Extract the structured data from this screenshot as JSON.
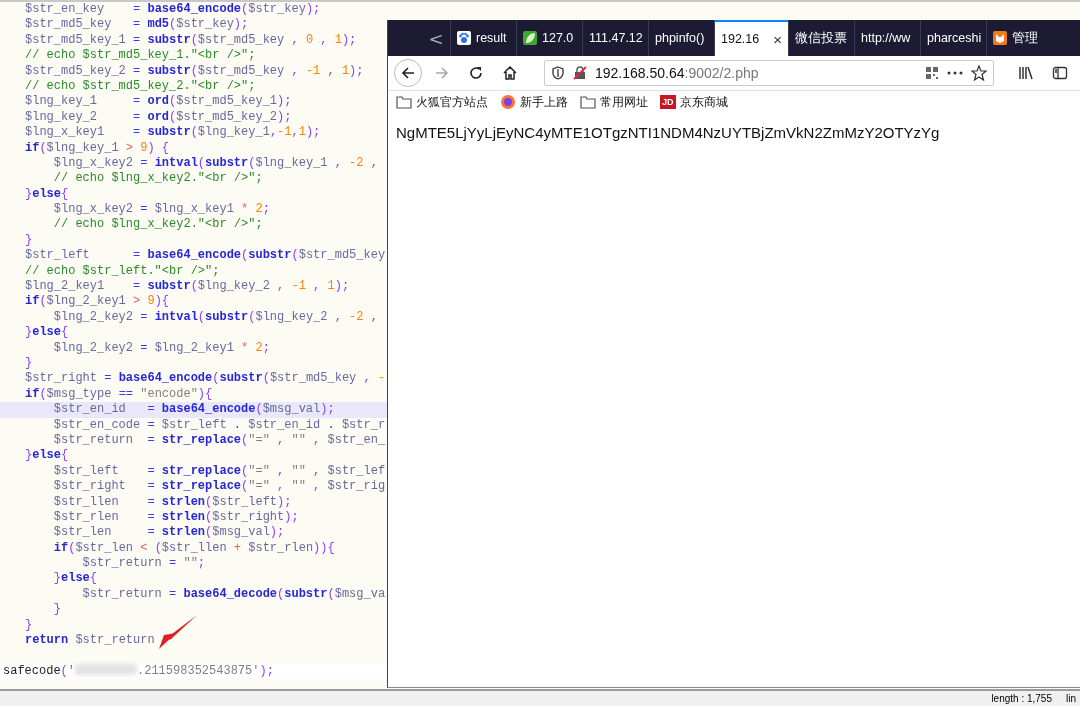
{
  "editor": {
    "lines": [
      {
        "tokens": [
          {
            "kind": "var",
            "text": "$str_en_key    "
          },
          {
            "kind": "op",
            "text": "= "
          },
          {
            "kind": "fn",
            "text": "base64_encode"
          },
          {
            "kind": "punct",
            "text": "("
          },
          {
            "kind": "var",
            "text": "$str_key"
          },
          {
            "kind": "punct",
            "text": ");"
          }
        ]
      },
      {
        "tokens": [
          {
            "kind": "var",
            "text": "$str_md5_key   "
          },
          {
            "kind": "op",
            "text": "= "
          },
          {
            "kind": "fn",
            "text": "md5"
          },
          {
            "kind": "punct",
            "text": "("
          },
          {
            "kind": "var",
            "text": "$str_key"
          },
          {
            "kind": "punct",
            "text": ");"
          }
        ]
      },
      {
        "tokens": [
          {
            "kind": "var",
            "text": "$str_md5_key_1 "
          },
          {
            "kind": "op",
            "text": "= "
          },
          {
            "kind": "fn",
            "text": "substr"
          },
          {
            "kind": "punct",
            "text": "("
          },
          {
            "kind": "var",
            "text": "$str_md5_key "
          },
          {
            "kind": "punct",
            "text": ", "
          },
          {
            "kind": "num",
            "text": "0 "
          },
          {
            "kind": "punct",
            "text": ", "
          },
          {
            "kind": "num",
            "text": "1"
          },
          {
            "kind": "punct",
            "text": ");"
          }
        ]
      },
      {
        "tokens": [
          {
            "kind": "comment",
            "text": "// echo $str_md5_key_1.\"<br />\";"
          }
        ]
      },
      {
        "tokens": [
          {
            "kind": "var",
            "text": "$str_md5_key_2 "
          },
          {
            "kind": "op",
            "text": "= "
          },
          {
            "kind": "fn",
            "text": "substr"
          },
          {
            "kind": "punct",
            "text": "("
          },
          {
            "kind": "var",
            "text": "$str_md5_key "
          },
          {
            "kind": "punct",
            "text": ", "
          },
          {
            "kind": "num",
            "text": "-1 "
          },
          {
            "kind": "punct",
            "text": ", "
          },
          {
            "kind": "num",
            "text": "1"
          },
          {
            "kind": "punct",
            "text": ");"
          }
        ]
      },
      {
        "tokens": [
          {
            "kind": "comment",
            "text": "// echo $str_md5_key_2.\"<br />\";"
          }
        ]
      },
      {
        "tokens": [
          {
            "kind": "var",
            "text": "$lng_key_1     "
          },
          {
            "kind": "op",
            "text": "= "
          },
          {
            "kind": "fn",
            "text": "ord"
          },
          {
            "kind": "punct",
            "text": "("
          },
          {
            "kind": "var",
            "text": "$str_md5_key_1"
          },
          {
            "kind": "punct",
            "text": ");"
          }
        ]
      },
      {
        "tokens": [
          {
            "kind": "var",
            "text": "$lng_key_2     "
          },
          {
            "kind": "op",
            "text": "= "
          },
          {
            "kind": "fn",
            "text": "ord"
          },
          {
            "kind": "punct",
            "text": "("
          },
          {
            "kind": "var",
            "text": "$str_md5_key_2"
          },
          {
            "kind": "punct",
            "text": ");"
          }
        ]
      },
      {
        "tokens": [
          {
            "kind": "var",
            "text": "$lng_x_key1    "
          },
          {
            "kind": "op",
            "text": "= "
          },
          {
            "kind": "fn",
            "text": "substr"
          },
          {
            "kind": "punct",
            "text": "("
          },
          {
            "kind": "var",
            "text": "$lng_key_1"
          },
          {
            "kind": "punct",
            "text": ","
          },
          {
            "kind": "num",
            "text": "-1"
          },
          {
            "kind": "punct",
            "text": ","
          },
          {
            "kind": "num",
            "text": "1"
          },
          {
            "kind": "punct",
            "text": ");"
          }
        ]
      },
      {
        "tokens": [
          {
            "kind": "fn",
            "text": "if"
          },
          {
            "kind": "punct",
            "text": "("
          },
          {
            "kind": "var",
            "text": "$lng_key_1 "
          },
          {
            "kind": "cmp",
            "text": "> "
          },
          {
            "kind": "num",
            "text": "9"
          },
          {
            "kind": "punct",
            "text": ") {"
          }
        ]
      },
      {
        "tokens": [
          {
            "kind": "var",
            "text": "    $lng_x_key2 "
          },
          {
            "kind": "op",
            "text": "= "
          },
          {
            "kind": "fn",
            "text": "intval"
          },
          {
            "kind": "punct",
            "text": "("
          },
          {
            "kind": "fn",
            "text": "substr"
          },
          {
            "kind": "punct",
            "text": "("
          },
          {
            "kind": "var",
            "text": "$lng_key_1 "
          },
          {
            "kind": "punct",
            "text": ", "
          },
          {
            "kind": "num",
            "text": "-2 "
          },
          {
            "kind": "punct",
            "text": ","
          }
        ]
      },
      {
        "tokens": [
          {
            "kind": "comment",
            "text": "    // echo $lng_x_key2.\"<br />\";"
          }
        ]
      },
      {
        "tokens": [
          {
            "kind": "punct",
            "text": "}"
          },
          {
            "kind": "fn",
            "text": "else"
          },
          {
            "kind": "punct",
            "text": "{"
          }
        ]
      },
      {
        "tokens": [
          {
            "kind": "var",
            "text": "    $lng_x_key2 "
          },
          {
            "kind": "op",
            "text": "= "
          },
          {
            "kind": "var",
            "text": "$lng_x_key1 "
          },
          {
            "kind": "cmp",
            "text": "* "
          },
          {
            "kind": "num",
            "text": "2"
          },
          {
            "kind": "punct",
            "text": ";"
          }
        ]
      },
      {
        "tokens": [
          {
            "kind": "comment",
            "text": "    // echo $lng_x_key2.\"<br />\";"
          }
        ]
      },
      {
        "tokens": [
          {
            "kind": "punct",
            "text": "}"
          }
        ]
      },
      {
        "tokens": [
          {
            "kind": "var",
            "text": "$str_left      "
          },
          {
            "kind": "op",
            "text": "= "
          },
          {
            "kind": "fn",
            "text": "base64_encode"
          },
          {
            "kind": "punct",
            "text": "("
          },
          {
            "kind": "fn",
            "text": "substr"
          },
          {
            "kind": "punct",
            "text": "("
          },
          {
            "kind": "var",
            "text": "$str_md5_key"
          }
        ]
      },
      {
        "tokens": [
          {
            "kind": "comment",
            "text": "// echo $str_left.\"<br />\";"
          }
        ]
      },
      {
        "tokens": [
          {
            "kind": "var",
            "text": "$lng_2_key1    "
          },
          {
            "kind": "op",
            "text": "= "
          },
          {
            "kind": "fn",
            "text": "substr"
          },
          {
            "kind": "punct",
            "text": "("
          },
          {
            "kind": "var",
            "text": "$lng_key_2 "
          },
          {
            "kind": "punct",
            "text": ", "
          },
          {
            "kind": "num",
            "text": "-1 "
          },
          {
            "kind": "punct",
            "text": ", "
          },
          {
            "kind": "num",
            "text": "1"
          },
          {
            "kind": "punct",
            "text": ");"
          }
        ]
      },
      {
        "tokens": [
          {
            "kind": "fn",
            "text": "if"
          },
          {
            "kind": "punct",
            "text": "("
          },
          {
            "kind": "var",
            "text": "$lng_2_key1 "
          },
          {
            "kind": "cmp",
            "text": "> "
          },
          {
            "kind": "num",
            "text": "9"
          },
          {
            "kind": "punct",
            "text": "){"
          }
        ]
      },
      {
        "tokens": [
          {
            "kind": "var",
            "text": "    $lng_2_key2 "
          },
          {
            "kind": "op",
            "text": "= "
          },
          {
            "kind": "fn",
            "text": "intval"
          },
          {
            "kind": "punct",
            "text": "("
          },
          {
            "kind": "fn",
            "text": "substr"
          },
          {
            "kind": "punct",
            "text": "("
          },
          {
            "kind": "var",
            "text": "$lng_key_2 "
          },
          {
            "kind": "punct",
            "text": ", "
          },
          {
            "kind": "num",
            "text": "-2 "
          },
          {
            "kind": "punct",
            "text": ","
          }
        ]
      },
      {
        "tokens": [
          {
            "kind": "punct",
            "text": "}"
          },
          {
            "kind": "fn",
            "text": "else"
          },
          {
            "kind": "punct",
            "text": "{"
          }
        ]
      },
      {
        "tokens": [
          {
            "kind": "var",
            "text": "    $lng_2_key2 "
          },
          {
            "kind": "op",
            "text": "= "
          },
          {
            "kind": "var",
            "text": "$lng_2_key1 "
          },
          {
            "kind": "cmp",
            "text": "* "
          },
          {
            "kind": "num",
            "text": "2"
          },
          {
            "kind": "punct",
            "text": ";"
          }
        ]
      },
      {
        "tokens": [
          {
            "kind": "punct",
            "text": "}"
          }
        ]
      },
      {
        "tokens": [
          {
            "kind": "var",
            "text": "$str_right "
          },
          {
            "kind": "op",
            "text": "= "
          },
          {
            "kind": "fn",
            "text": "base64_encode"
          },
          {
            "kind": "punct",
            "text": "("
          },
          {
            "kind": "fn",
            "text": "substr"
          },
          {
            "kind": "punct",
            "text": "("
          },
          {
            "kind": "var",
            "text": "$str_md5_key "
          },
          {
            "kind": "punct",
            "text": ", "
          },
          {
            "kind": "num",
            "text": "-"
          }
        ]
      },
      {
        "tokens": [
          {
            "kind": "fn",
            "text": "if"
          },
          {
            "kind": "punct",
            "text": "("
          },
          {
            "kind": "var",
            "text": "$msg_type "
          },
          {
            "kind": "op",
            "text": "== "
          },
          {
            "kind": "str",
            "text": "\"encode\""
          },
          {
            "kind": "punct",
            "text": "){"
          }
        ]
      },
      {
        "current": true,
        "tokens": [
          {
            "kind": "var",
            "text": "    $str_en_id   "
          },
          {
            "kind": "op",
            "text": "= "
          },
          {
            "kind": "fn",
            "text": "base64_encode"
          },
          {
            "kind": "punct",
            "text": "("
          },
          {
            "kind": "var",
            "text": "$msg_val"
          },
          {
            "kind": "punct",
            "text": ");"
          }
        ]
      },
      {
        "tokens": [
          {
            "kind": "var",
            "text": "    $str_en_code "
          },
          {
            "kind": "op",
            "text": "= "
          },
          {
            "kind": "var",
            "text": "$str_left "
          },
          {
            "kind": "op",
            "text": ". "
          },
          {
            "kind": "var",
            "text": "$str_en_id "
          },
          {
            "kind": "op",
            "text": ". "
          },
          {
            "kind": "var",
            "text": "$str_r"
          }
        ]
      },
      {
        "tokens": [
          {
            "kind": "var",
            "text": "    $str_return  "
          },
          {
            "kind": "op",
            "text": "= "
          },
          {
            "kind": "fn",
            "text": "str_replace"
          },
          {
            "kind": "punct",
            "text": "("
          },
          {
            "kind": "str",
            "text": "\"=\" "
          },
          {
            "kind": "punct",
            "text": ", "
          },
          {
            "kind": "str",
            "text": "\"\" "
          },
          {
            "kind": "punct",
            "text": ", "
          },
          {
            "kind": "var",
            "text": "$str_en_"
          }
        ]
      },
      {
        "tokens": [
          {
            "kind": "punct",
            "text": "}"
          },
          {
            "kind": "fn",
            "text": "else"
          },
          {
            "kind": "punct",
            "text": "{"
          }
        ]
      },
      {
        "tokens": [
          {
            "kind": "var",
            "text": "    $str_left    "
          },
          {
            "kind": "op",
            "text": "= "
          },
          {
            "kind": "fn",
            "text": "str_replace"
          },
          {
            "kind": "punct",
            "text": "("
          },
          {
            "kind": "str",
            "text": "\"=\" "
          },
          {
            "kind": "punct",
            "text": ", "
          },
          {
            "kind": "str",
            "text": "\"\" "
          },
          {
            "kind": "punct",
            "text": ", "
          },
          {
            "kind": "var",
            "text": "$str_lef"
          }
        ]
      },
      {
        "tokens": [
          {
            "kind": "var",
            "text": "    $str_right   "
          },
          {
            "kind": "op",
            "text": "= "
          },
          {
            "kind": "fn",
            "text": "str_replace"
          },
          {
            "kind": "punct",
            "text": "("
          },
          {
            "kind": "str",
            "text": "\"=\" "
          },
          {
            "kind": "punct",
            "text": ", "
          },
          {
            "kind": "str",
            "text": "\"\" "
          },
          {
            "kind": "punct",
            "text": ", "
          },
          {
            "kind": "var",
            "text": "$str_rig"
          }
        ]
      },
      {
        "tokens": [
          {
            "kind": "var",
            "text": "    $str_llen    "
          },
          {
            "kind": "op",
            "text": "= "
          },
          {
            "kind": "fn",
            "text": "strlen"
          },
          {
            "kind": "punct",
            "text": "("
          },
          {
            "kind": "var",
            "text": "$str_left"
          },
          {
            "kind": "punct",
            "text": ");"
          }
        ]
      },
      {
        "tokens": [
          {
            "kind": "var",
            "text": "    $str_rlen    "
          },
          {
            "kind": "op",
            "text": "= "
          },
          {
            "kind": "fn",
            "text": "strlen"
          },
          {
            "kind": "punct",
            "text": "("
          },
          {
            "kind": "var",
            "text": "$str_right"
          },
          {
            "kind": "punct",
            "text": ");"
          }
        ]
      },
      {
        "tokens": [
          {
            "kind": "var",
            "text": "    $str_len     "
          },
          {
            "kind": "op",
            "text": "= "
          },
          {
            "kind": "fn",
            "text": "strlen"
          },
          {
            "kind": "punct",
            "text": "("
          },
          {
            "kind": "var",
            "text": "$msg_val"
          },
          {
            "kind": "punct",
            "text": ");"
          }
        ]
      },
      {
        "tokens": [
          {
            "kind": "fn",
            "text": "    if"
          },
          {
            "kind": "punct",
            "text": "("
          },
          {
            "kind": "var",
            "text": "$str_len "
          },
          {
            "kind": "cmp",
            "text": "< "
          },
          {
            "kind": "punct",
            "text": "("
          },
          {
            "kind": "var",
            "text": "$str_llen "
          },
          {
            "kind": "cmp",
            "text": "+ "
          },
          {
            "kind": "var",
            "text": "$str_rlen"
          },
          {
            "kind": "punct",
            "text": ")){"
          }
        ]
      },
      {
        "tokens": [
          {
            "kind": "var",
            "text": "        $str_return "
          },
          {
            "kind": "op",
            "text": "= "
          },
          {
            "kind": "str",
            "text": "\"\""
          },
          {
            "kind": "punct",
            "text": ";"
          }
        ]
      },
      {
        "tokens": [
          {
            "kind": "punct",
            "text": "    }"
          },
          {
            "kind": "fn",
            "text": "else"
          },
          {
            "kind": "punct",
            "text": "{"
          }
        ]
      },
      {
        "tokens": [
          {
            "kind": "var",
            "text": "        $str_return "
          },
          {
            "kind": "op",
            "text": "= "
          },
          {
            "kind": "fn",
            "text": "base64_decode"
          },
          {
            "kind": "punct",
            "text": "("
          },
          {
            "kind": "fn",
            "text": "substr"
          },
          {
            "kind": "punct",
            "text": "("
          },
          {
            "kind": "var",
            "text": "$msg_va"
          }
        ]
      },
      {
        "tokens": [
          {
            "kind": "punct",
            "text": "    }"
          }
        ]
      },
      {
        "tokens": [
          {
            "kind": "punct",
            "text": "}"
          }
        ]
      },
      {
        "tokens": [
          {
            "kind": "fn",
            "text": "return "
          },
          {
            "kind": "var",
            "text": "$str_return"
          }
        ]
      }
    ],
    "call_line": {
      "tokens": [
        {
          "kind": "plain",
          "text": "safecode"
        },
        {
          "kind": "punct",
          "text": "('"
        },
        {
          "kind": "redacted"
        },
        {
          "kind": "str",
          "text": ".211598352543875'"
        },
        {
          "kind": "punct",
          "text": ");"
        }
      ]
    },
    "status_bar": {
      "length": "length : 1,755",
      "lines": "lin"
    }
  },
  "browser": {
    "back_tabs": "<",
    "tabs": [
      {
        "title": "result",
        "kind": "paw",
        "selected": false
      },
      {
        "title": "127.0",
        "kind": "leaf",
        "selected": false
      },
      {
        "title": "111.47.12",
        "kind": "plain",
        "selected": false
      },
      {
        "title": "phpinfo()",
        "kind": "plain",
        "selected": false
      },
      {
        "title": "192.16",
        "kind": "plain",
        "selected": true,
        "close": "×"
      },
      {
        "title": "微信投票",
        "kind": "plain",
        "selected": false
      },
      {
        "title": "http://ww",
        "kind": "plain",
        "selected": false
      },
      {
        "title": "pharceshi",
        "kind": "plain",
        "selected": false
      },
      {
        "title": "管理",
        "kind": "fox",
        "selected": false
      }
    ],
    "address": {
      "host": "192.168.50.64",
      "rest": ":9002/2.php"
    },
    "bookmarks": [
      {
        "label": "火狐官方站点",
        "kind": "folder"
      },
      {
        "label": "新手上路",
        "kind": "firefox"
      },
      {
        "label": "常用网址",
        "kind": "folder"
      },
      {
        "label": "京东商城",
        "kind": "jd",
        "badge": "JD"
      }
    ],
    "content": "NgMTE5LjYyLjEyNC4yMTE1OTgzNTI1NDM4NzUYTBjZmVkN2ZmMzY2OTYzYg"
  }
}
